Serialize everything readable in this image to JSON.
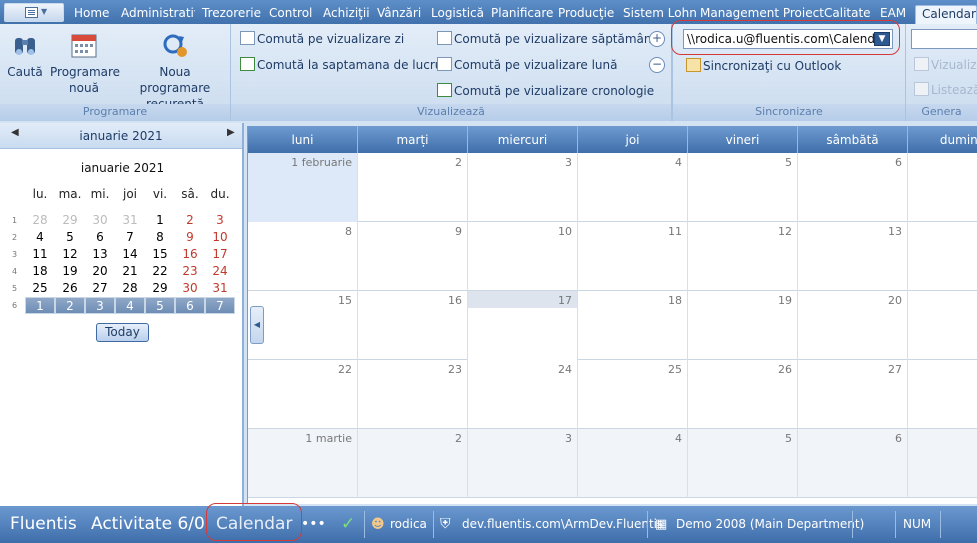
{
  "menubar": {
    "tabs": [
      "Home",
      "Administrativ",
      "Trezorerie",
      "Control",
      "Achiziţii",
      "Vânzări",
      "Logistică",
      "Planificare",
      "Producţie",
      "Sistem Lohn",
      "Management Proiect",
      "Calitate",
      "EAM",
      "Calendar"
    ],
    "active_tab": "Calendar"
  },
  "ribbon": {
    "programare": {
      "label": "Programare",
      "search": "Caută",
      "new_line1": "Programare",
      "new_line2": "nouă",
      "recurrent_line1": "Noua programare",
      "recurrent_line2": "recurentă"
    },
    "vizualizeaza": {
      "label": "Vizualizează",
      "day": "Comută pe vizualizare zi",
      "workweek": "Comută la saptamana de lucru",
      "week": "Comută pe vizualizare săptămână",
      "month": "Comută pe vizualizare lună",
      "timeline": "Comută pe vizualizare cronologie"
    },
    "sincronizare": {
      "label": "Sincronizare",
      "calendar_path": "\\\\rodica.u@fluentis.com\\Calendar",
      "outlook": "Sincronizaţi cu Outlook"
    },
    "genera": {
      "label": "Genera",
      "view": "Vizualiz",
      "list": "Listează"
    }
  },
  "minicalendar": {
    "header_title": "ianuarie 2021",
    "title": "ianuarie 2021",
    "weekdays": [
      "lu.",
      "ma.",
      "mi.",
      "joi",
      "vi.",
      "sâ.",
      "du."
    ],
    "weeks": [
      {
        "num": "1",
        "days": [
          "28",
          "29",
          "30",
          "31",
          "1",
          "2",
          "3"
        ]
      },
      {
        "num": "2",
        "days": [
          "4",
          "5",
          "6",
          "7",
          "8",
          "9",
          "10"
        ]
      },
      {
        "num": "3",
        "days": [
          "11",
          "12",
          "13",
          "14",
          "15",
          "16",
          "17"
        ]
      },
      {
        "num": "4",
        "days": [
          "18",
          "19",
          "20",
          "21",
          "22",
          "23",
          "24"
        ]
      },
      {
        "num": "5",
        "days": [
          "25",
          "26",
          "27",
          "28",
          "29",
          "30",
          "31"
        ]
      },
      {
        "num": "6",
        "days": [
          "1",
          "2",
          "3",
          "4",
          "5",
          "6",
          "7"
        ]
      }
    ],
    "today_button": "Today"
  },
  "month_view": {
    "weekdays": [
      "luni",
      "marți",
      "miercuri",
      "joi",
      "vineri",
      "sâmbătă",
      "duminică"
    ],
    "rows": [
      [
        "1 februarie",
        "2",
        "3",
        "4",
        "5",
        "6",
        ""
      ],
      [
        "8",
        "9",
        "10",
        "11",
        "12",
        "13",
        ""
      ],
      [
        "15",
        "16",
        "17",
        "18",
        "19",
        "20",
        ""
      ],
      [
        "22",
        "23",
        "24",
        "25",
        "26",
        "27",
        ""
      ],
      [
        "1 martie",
        "2",
        "3",
        "4",
        "5",
        "6",
        ""
      ]
    ]
  },
  "statusbar": {
    "app": "Fluentis",
    "activity": "Activitate 6/0",
    "module": "Calendar",
    "more": "•••",
    "user": "rodica",
    "server": "dev.fluentis.com\\ArmDev.Fluentis",
    "company": "Demo 2008 (Main Department)",
    "num": "NUM"
  },
  "colors": {
    "accent": "#4171ad",
    "ribbon_bg": "#dce8f6",
    "highlight_ring": "#d43a3a",
    "weekend_text": "#c0392b"
  }
}
